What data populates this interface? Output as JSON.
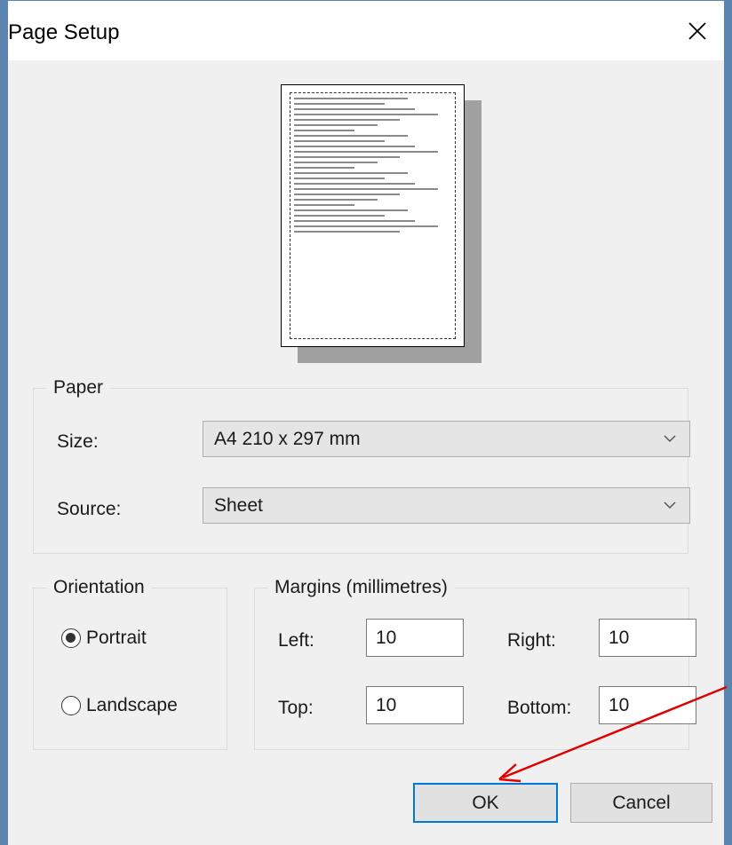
{
  "window": {
    "title": "Page Setup"
  },
  "paper": {
    "group_label": "Paper",
    "size_label": "Size:",
    "size_value": "A4 210 x 297 mm",
    "source_label": "Source:",
    "source_value": "Sheet"
  },
  "orientation": {
    "group_label": "Orientation",
    "portrait_label": "Portrait",
    "landscape_label": "Landscape",
    "selected": "Portrait"
  },
  "margins": {
    "group_label": "Margins (millimetres)",
    "left_label": "Left:",
    "left_value": "10",
    "right_label": "Right:",
    "right_value": "10",
    "top_label": "Top:",
    "top_value": "10",
    "bottom_label": "Bottom:",
    "bottom_value": "10"
  },
  "buttons": {
    "ok_label": "OK",
    "cancel_label": "Cancel"
  },
  "colors": {
    "frame": "#5b84b0",
    "annotation_arrow": "#e00000",
    "default_button_border": "#0078d7"
  },
  "icons": {
    "close": "close-icon",
    "dropdown": "chevron-down-icon"
  }
}
